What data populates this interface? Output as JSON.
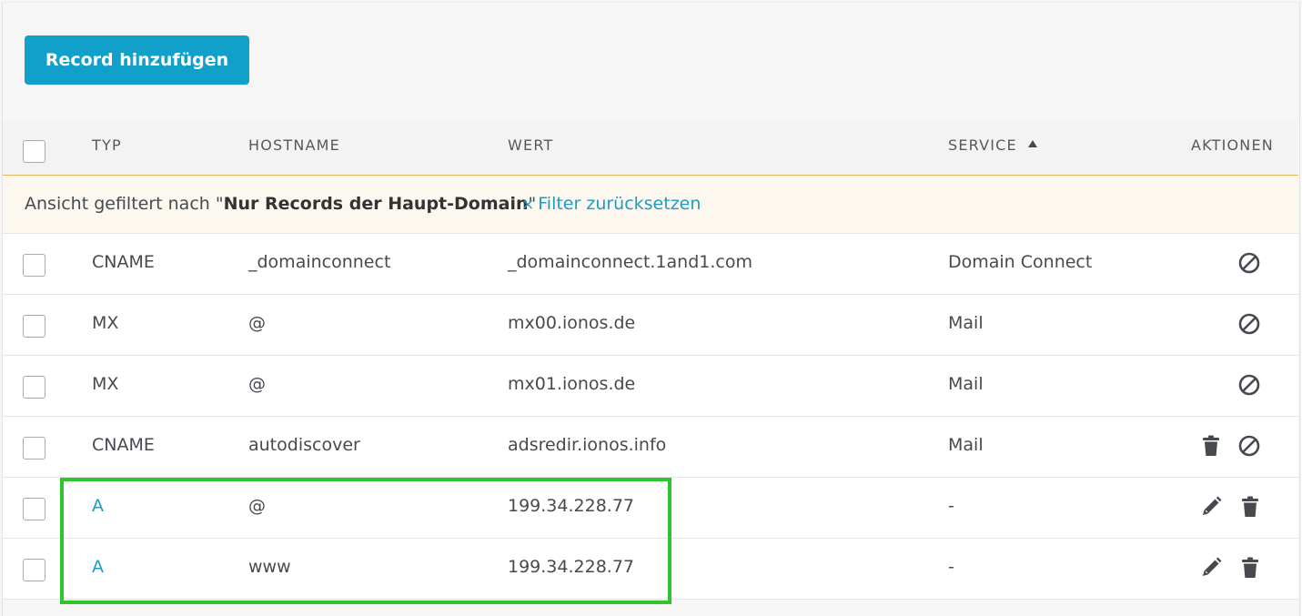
{
  "toolbar": {
    "add_label": "Record hinzufügen"
  },
  "table": {
    "headers": {
      "type": "TYP",
      "hostname": "HOSTNAME",
      "value": "WERT",
      "service": "SERVICE",
      "actions": "AKTIONEN"
    },
    "filter": {
      "prefix": "Ansicht gefiltert nach \"",
      "name": "Nur Records der Haupt-Domain",
      "suffix": "\"",
      "reset_icon": "×",
      "reset_label": "Filter zurücksetzen"
    },
    "rows": [
      {
        "type": "CNAME",
        "hostname": "_domainconnect",
        "value": "_domainconnect.1and1.com",
        "service": "Domain Connect"
      },
      {
        "type": "MX",
        "hostname": "@",
        "value": "mx00.ionos.de",
        "service": "Mail"
      },
      {
        "type": "MX",
        "hostname": "@",
        "value": "mx01.ionos.de",
        "service": "Mail"
      },
      {
        "type": "CNAME",
        "hostname": "autodiscover",
        "value": "adsredir.ionos.info",
        "service": "Mail"
      },
      {
        "type": "A",
        "hostname": "@",
        "value": "199.34.228.77",
        "service": "-"
      },
      {
        "type": "A",
        "hostname": "www",
        "value": "199.34.228.77",
        "service": "-"
      }
    ]
  },
  "colors": {
    "accent": "#11a0c9",
    "link": "#1e9bc4",
    "highlight": "#2fc52d",
    "filter_bg": "#fdf8ef"
  },
  "icons": {
    "sort": "sort-ascending-icon",
    "block": "block-icon",
    "trash": "trash-icon",
    "edit": "pencil-icon"
  }
}
